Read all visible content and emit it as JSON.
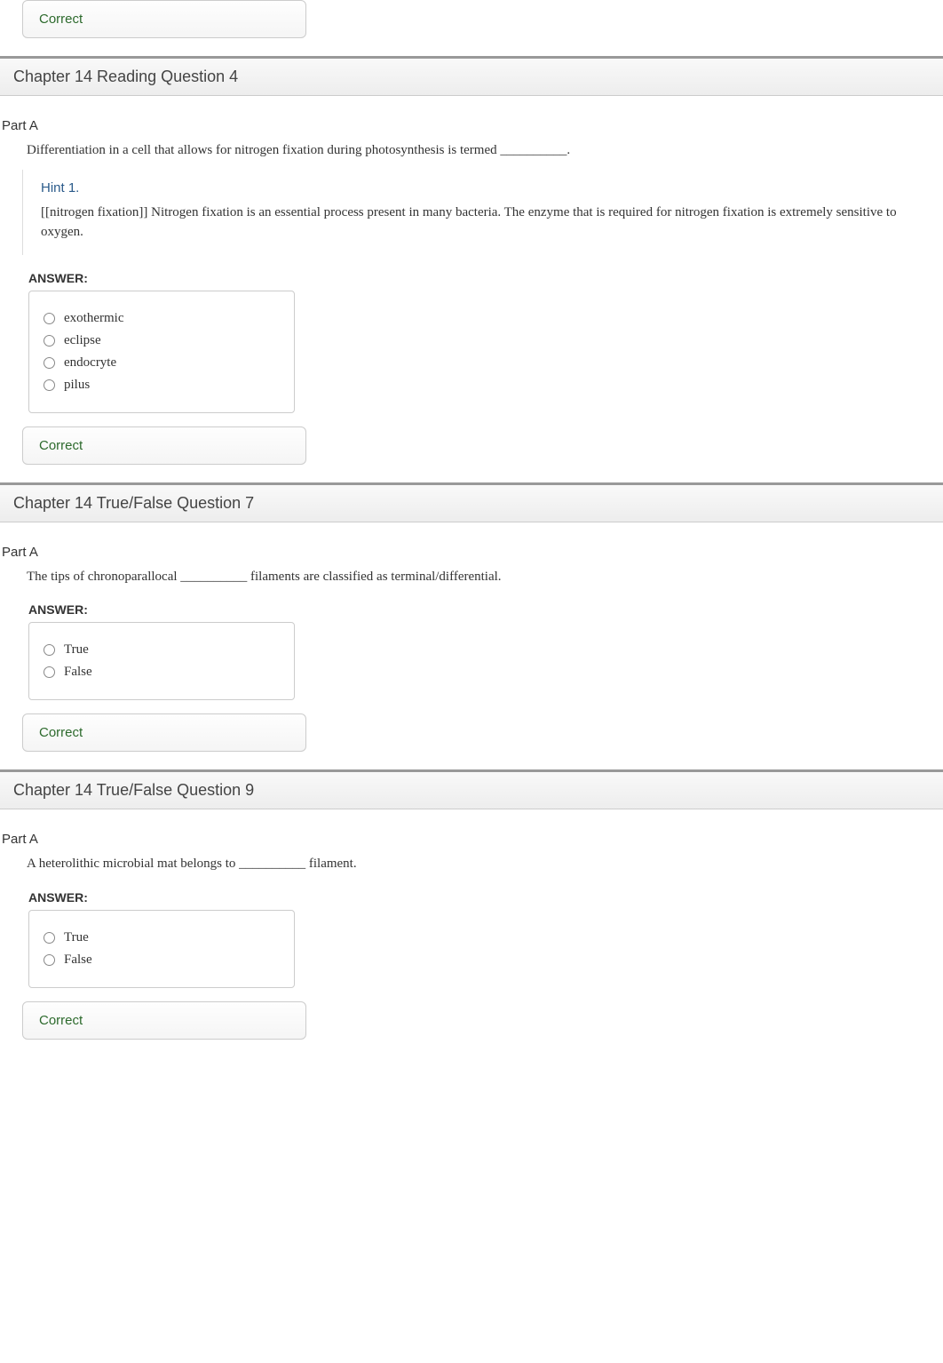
{
  "correct_label": "Correct",
  "q4": {
    "header": "Chapter 14 Reading Question 4",
    "part": "Part A",
    "prompt": "Differentiation in a cell that allows for nitrogen fixation during photosynthesis is termed __________.",
    "hint_title": "Hint 1.",
    "hint_body": "[[nitrogen fixation]] Nitrogen fixation is an essential process present in many bacteria. The enzyme that is required for nitrogen fixation is extremely sensitive to oxygen.",
    "answer_label": "ANSWER:",
    "options": [
      "exothermic",
      "eclipse",
      "endocryte",
      "pilus"
    ]
  },
  "q5": {
    "header": "Chapter 14 True/False Question 7",
    "part": "Part A",
    "prompt": "The tips of chronoparallocal __________ filaments are classified as terminal/differential.",
    "answer_label": "ANSWER:",
    "options": [
      "True",
      "False"
    ]
  },
  "q6": {
    "header": "Chapter 14 True/False Question 9",
    "part": "Part A",
    "prompt": "A heterolithic microbial mat belongs to __________ filament.",
    "answer_label": "ANSWER:",
    "options": [
      "True",
      "False"
    ]
  }
}
